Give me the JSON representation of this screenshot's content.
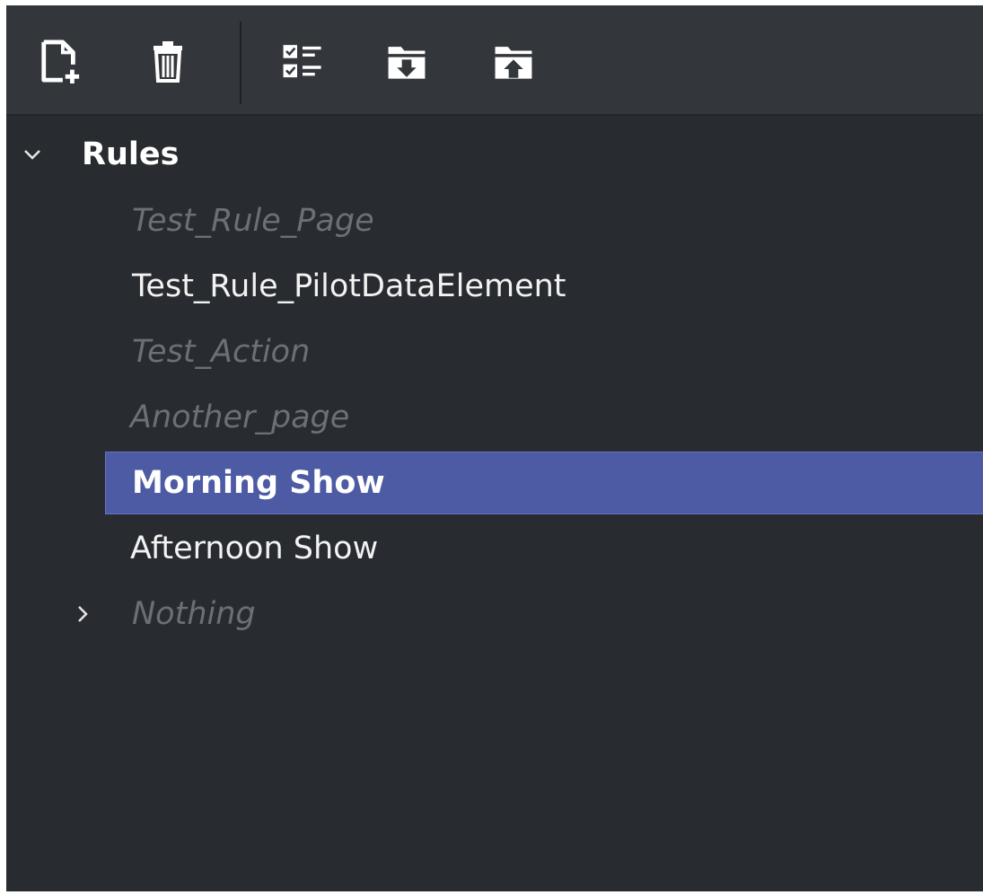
{
  "toolbar": {
    "buttons": [
      {
        "name": "new-document-icon"
      },
      {
        "name": "trash-icon"
      },
      {
        "name": "checklist-icon"
      },
      {
        "name": "folder-download-icon"
      },
      {
        "name": "folder-upload-icon"
      }
    ]
  },
  "tree": {
    "root": {
      "label": "Rules",
      "expanded": true
    },
    "items": [
      {
        "label": "Test_Rule_Page",
        "state": "disabled"
      },
      {
        "label": "Test_Rule_PilotDataElement",
        "state": "enabled"
      },
      {
        "label": "Test_Action",
        "state": "disabled"
      },
      {
        "label": "Another_page",
        "state": "disabled"
      },
      {
        "label": "Morning Show",
        "state": "selected"
      },
      {
        "label": "Afternoon Show",
        "state": "enabled"
      },
      {
        "label": "Nothing",
        "state": "disabled",
        "collapsed": true
      }
    ]
  },
  "colors": {
    "background": "#282b2f",
    "toolbar": "#33363b",
    "selection": "#4d5ba4",
    "text": "#f2f2f2",
    "disabled_text": "#6c6f74"
  }
}
